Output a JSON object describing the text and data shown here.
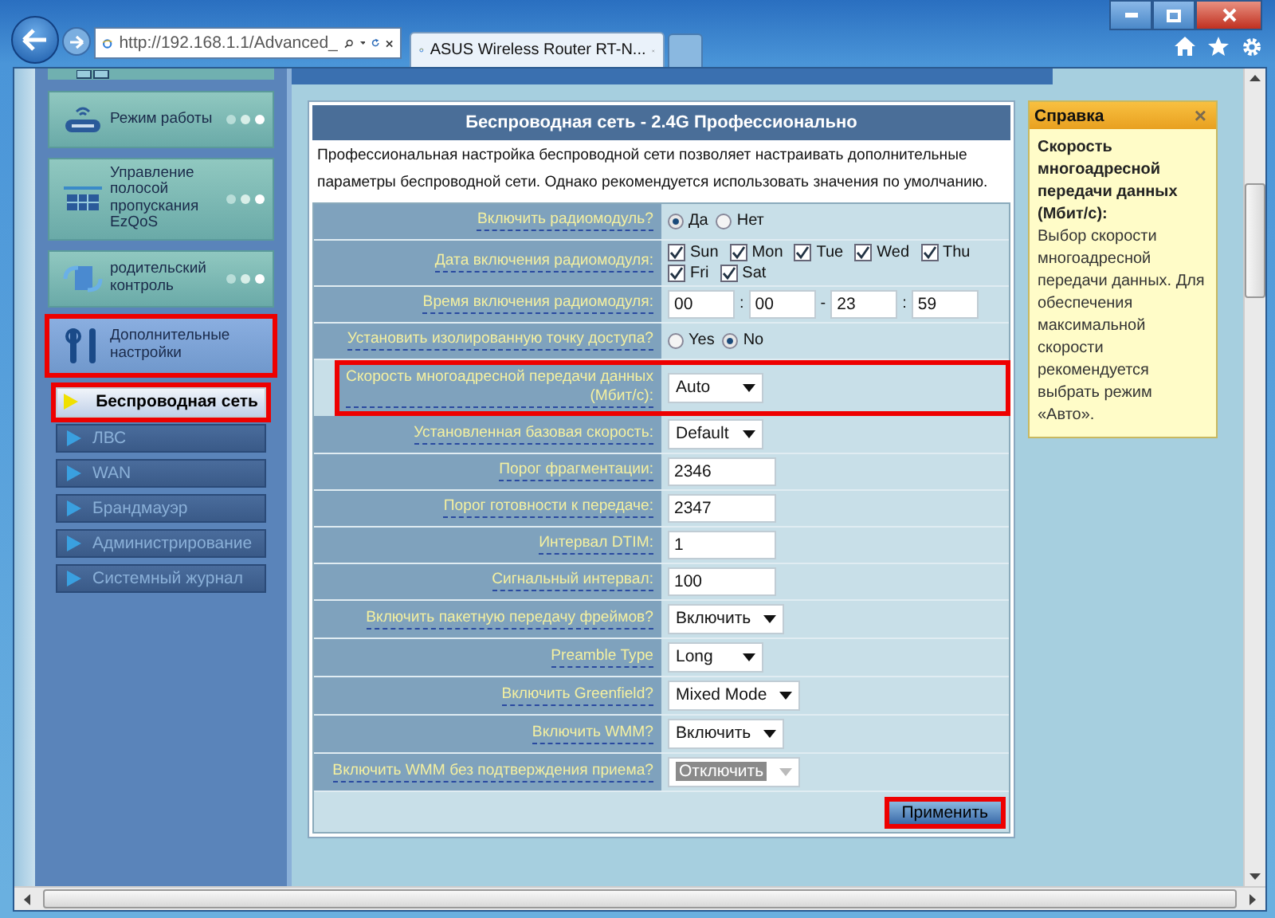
{
  "browser": {
    "address": "http://192.168.1.1/Advanced_",
    "tab_title": "ASUS Wireless Router RT-N..."
  },
  "sidebar": {
    "items": [
      {
        "label": "Режим работы",
        "expanded": false,
        "highlighted": false
      },
      {
        "label": "Управление полосой пропускания EzQoS",
        "expanded": false,
        "highlighted": false
      },
      {
        "label": "родительский контроль",
        "expanded": false,
        "highlighted": false
      },
      {
        "label": "Дополнительные настройки",
        "expanded": true,
        "highlighted": true
      }
    ],
    "submenu": [
      {
        "label": "Беспроводная сеть",
        "selected": true,
        "highlighted": true
      },
      {
        "label": "ЛВС",
        "selected": false,
        "highlighted": false
      },
      {
        "label": "WAN",
        "selected": false,
        "highlighted": false
      },
      {
        "label": "Брандмауэр",
        "selected": false,
        "highlighted": false
      },
      {
        "label": "Администрирование",
        "selected": false,
        "highlighted": false
      },
      {
        "label": "Системный журнал",
        "selected": false,
        "highlighted": false
      }
    ]
  },
  "panel": {
    "title": "Беспроводная сеть - 2.4G Профессионально",
    "description": "Профессиональная настройка беспроводной сети позволяет настраивать дополнительные параметры беспроводной сети. Однако рекомендуется использовать значения по умолчанию.",
    "rows": [
      {
        "kind": "radio",
        "label": "Включить радиомодуль?",
        "highlighted": false,
        "options": [
          {
            "label": "Да",
            "selected": true
          },
          {
            "label": "Нет",
            "selected": false
          }
        ]
      },
      {
        "kind": "checkboxes",
        "label": "Дата включения радиомодуля:",
        "highlighted": false,
        "options": [
          {
            "label": "Sun",
            "checked": true
          },
          {
            "label": "Mon",
            "checked": true
          },
          {
            "label": "Tue",
            "checked": true
          },
          {
            "label": "Wed",
            "checked": true
          },
          {
            "label": "Thu",
            "checked": true
          },
          {
            "label": "Fri",
            "checked": true
          },
          {
            "label": "Sat",
            "checked": true
          }
        ]
      },
      {
        "kind": "time",
        "label": "Время включения радиомодуля:",
        "highlighted": false,
        "values": [
          "00",
          "00",
          "23",
          "59"
        ],
        "separators": [
          ":",
          "-",
          ":"
        ]
      },
      {
        "kind": "radio",
        "label": "Установить изолированную точку доступа?",
        "highlighted": false,
        "options": [
          {
            "label": "Yes",
            "selected": false
          },
          {
            "label": "No",
            "selected": true
          }
        ]
      },
      {
        "kind": "select",
        "label": "Скорость многоадресной передачи данных (Мбит/с):",
        "highlighted": true,
        "value": "Auto",
        "disabled": false
      },
      {
        "kind": "select",
        "label": "Установленная базовая скорость:",
        "highlighted": false,
        "value": "Default",
        "disabled": false
      },
      {
        "kind": "text",
        "label": "Порог фрагментации:",
        "highlighted": false,
        "value": "2346"
      },
      {
        "kind": "text",
        "label": "Порог готовности к передаче:",
        "highlighted": false,
        "value": "2347"
      },
      {
        "kind": "text",
        "label": "Интервал DTIM:",
        "highlighted": false,
        "value": "1"
      },
      {
        "kind": "text",
        "label": "Сигнальный интервал:",
        "highlighted": false,
        "value": "100"
      },
      {
        "kind": "select",
        "label": "Включить пакетную передачу фреймов?",
        "highlighted": false,
        "value": "Включить",
        "disabled": false
      },
      {
        "kind": "select",
        "label": "Preamble Type",
        "highlighted": false,
        "value": "Long",
        "disabled": false
      },
      {
        "kind": "select",
        "label": "Включить Greenfield?",
        "highlighted": false,
        "value": "Mixed Mode",
        "disabled": false
      },
      {
        "kind": "select",
        "label": "Включить WMM?",
        "highlighted": false,
        "value": "Включить",
        "disabled": false
      },
      {
        "kind": "select",
        "label": "Включить WMM без подтверждения приема?",
        "highlighted": false,
        "value": "Отключить",
        "disabled": true
      }
    ],
    "apply": {
      "label": "Применить",
      "highlighted": true
    }
  },
  "help": {
    "title": "Справка",
    "close": "×",
    "heading": "Скорость многоадресной передачи данных (Мбит/с):",
    "body": "Выбор скорости многоадресной передачи данных. Для обеспечения максимальной скорости рекомендуется выбрать режим «Авто»."
  }
}
